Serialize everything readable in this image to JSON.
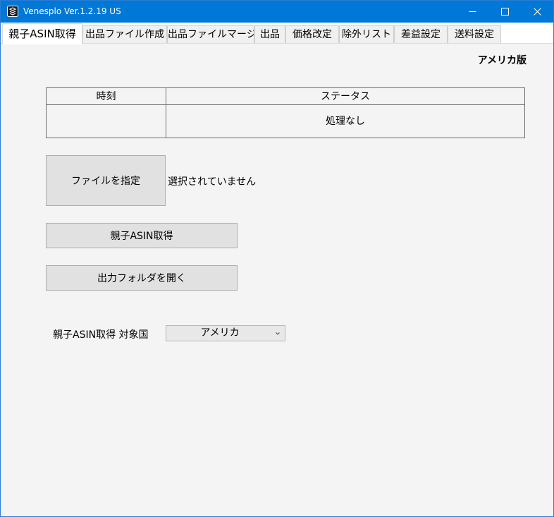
{
  "window": {
    "title": "Venesplo Ver.1.2.19 US"
  },
  "tabs": [
    {
      "label": "親子ASIN取得",
      "active": true
    },
    {
      "label": "出品ファイル作成",
      "active": false
    },
    {
      "label": "出品ファイルマージ",
      "active": false
    },
    {
      "label": "出品",
      "active": false
    },
    {
      "label": "価格改定",
      "active": false
    },
    {
      "label": "除外リスト",
      "active": false
    },
    {
      "label": "差益設定",
      "active": false
    },
    {
      "label": "送料設定",
      "active": false
    }
  ],
  "main": {
    "region_label": "アメリカ版",
    "status_table": {
      "headers": [
        "時刻",
        "ステータス"
      ],
      "rows": [
        {
          "time": "",
          "status": "処理なし"
        }
      ]
    },
    "file_button_label": "ファイルを指定",
    "file_status": "選択されていません",
    "fetch_button_label": "親子ASIN取得",
    "open_folder_button_label": "出力フォルダを開く",
    "country": {
      "label": "親子ASIN取得 対象国",
      "selected": "アメリカ"
    }
  },
  "colors": {
    "titlebar": "#0078d7",
    "background": "#f4f4f4",
    "button": "#e1e1e1"
  },
  "icons": {
    "app": "app-logo-icon",
    "minimize": "minimize-icon",
    "maximize": "maximize-icon",
    "close": "close-icon",
    "dropdown": "chevron-down-icon"
  }
}
